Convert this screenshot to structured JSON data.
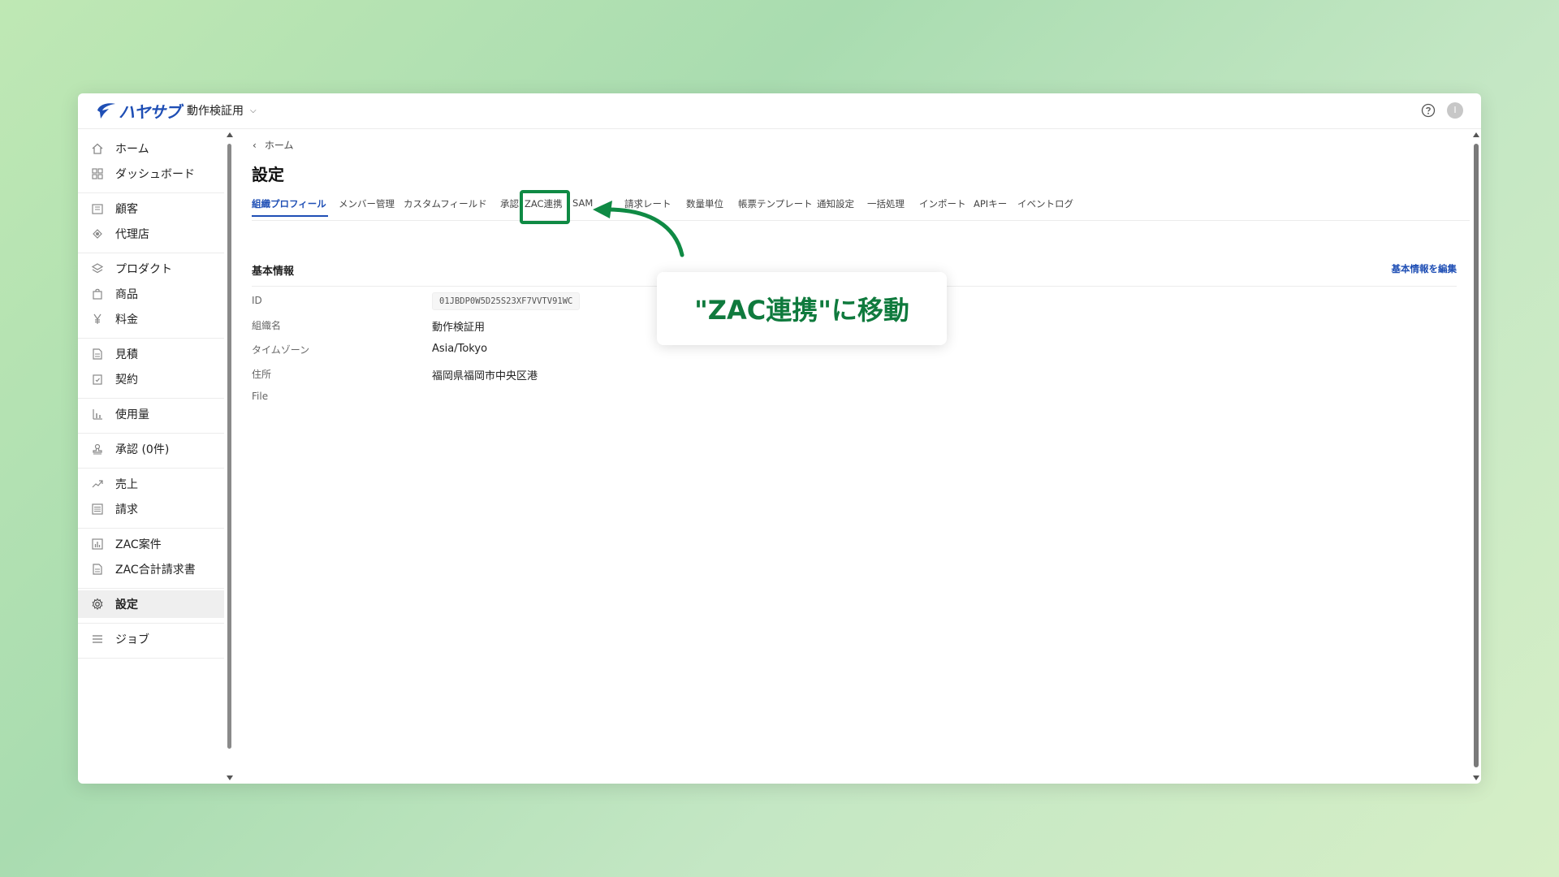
{
  "app": {
    "logo_text": "ハヤサブ",
    "workspace": "動作検証用",
    "brand_color": "#1f4fb5",
    "avatar_initial": "I"
  },
  "sidebar": {
    "items": [
      {
        "label": "ホーム",
        "icon": "home-icon"
      },
      {
        "label": "ダッシュボード",
        "icon": "dashboard-icon"
      },
      {
        "label": "顧客",
        "icon": "customer-icon"
      },
      {
        "label": "代理店",
        "icon": "agency-icon"
      },
      {
        "label": "プロダクト",
        "icon": "layers-icon"
      },
      {
        "label": "商品",
        "icon": "shopping-bag-icon"
      },
      {
        "label": "料金",
        "icon": "yen-icon"
      },
      {
        "label": "見積",
        "icon": "document-icon"
      },
      {
        "label": "契約",
        "icon": "clipboard-check-icon"
      },
      {
        "label": "使用量",
        "icon": "bar-chart-icon"
      },
      {
        "label": "承認 (0件)",
        "icon": "stamp-icon"
      },
      {
        "label": "売上",
        "icon": "trend-up-icon"
      },
      {
        "label": "請求",
        "icon": "list-icon"
      },
      {
        "label": "ZAC案件",
        "icon": "chart-box-icon"
      },
      {
        "label": "ZAC合計請求書",
        "icon": "document-icon"
      },
      {
        "label": "設定",
        "icon": "gear-icon"
      },
      {
        "label": "ジョブ",
        "icon": "list-lines-icon"
      }
    ],
    "active": "設定"
  },
  "main": {
    "breadcrumb": "ホーム",
    "title": "設定",
    "tabs": [
      "組織プロフィール",
      "メンバー管理",
      "カスタムフィールド",
      "承認",
      "ZAC連携",
      "SAM",
      "請求レート",
      "数量単位",
      "帳票テンプレート",
      "通知設定",
      "一括処理",
      "インポート",
      "APIキー",
      "イベントログ"
    ],
    "active_tab": "組織プロフィール",
    "section_title": "基本情報",
    "edit_link": "基本情報を編集",
    "fields": {
      "id_label": "ID",
      "id_value": "01JBDP0W5D25S23XF7VVTV91WC",
      "org_label": "組織名",
      "org_value": "動作検証用",
      "tz_label": "タイムゾーン",
      "tz_value": "Asia/Tokyo",
      "addr_label": "住所",
      "addr_value": "福岡県福岡市中央区港",
      "file_label": "File"
    }
  },
  "overlay": {
    "callout_text": "\"ZAC連携\"に移動",
    "accent_color": "#0f8a44"
  }
}
